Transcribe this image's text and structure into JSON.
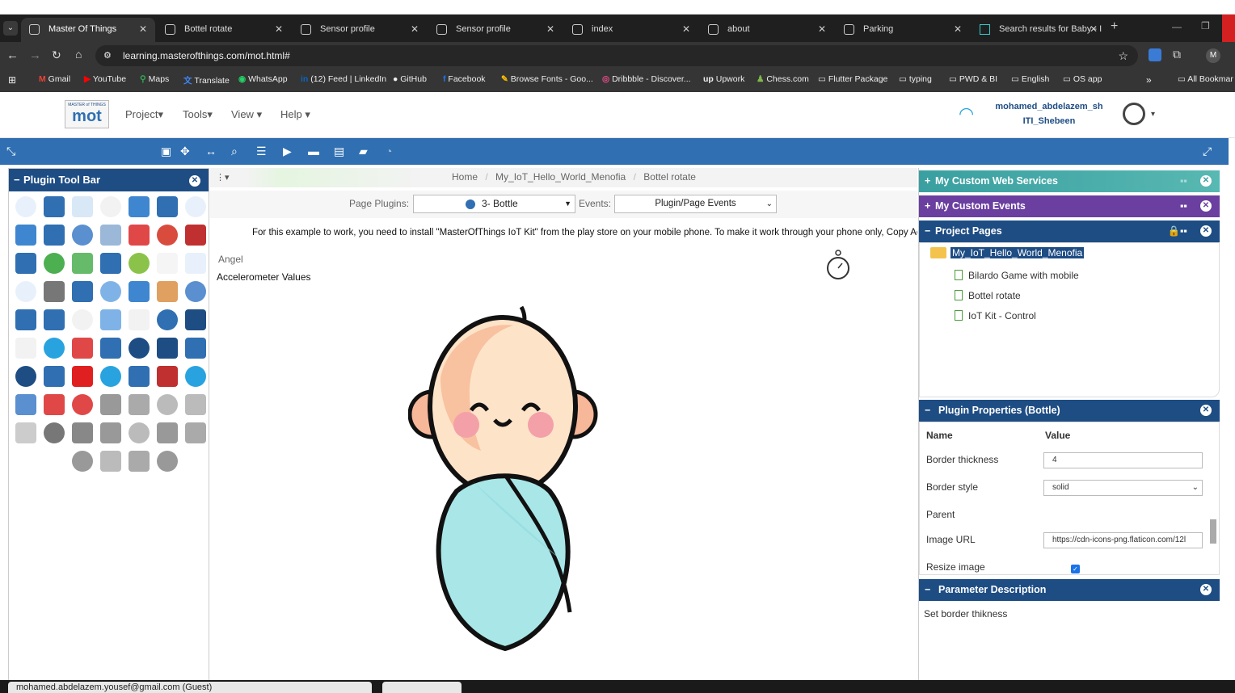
{
  "tabs": [
    {
      "title": "Master Of Things",
      "active": true
    },
    {
      "title": "Bottel rotate"
    },
    {
      "title": "Sensor profile"
    },
    {
      "title": "Sensor profile"
    },
    {
      "title": "index"
    },
    {
      "title": "about"
    },
    {
      "title": "Parking"
    },
    {
      "title": "Search results for Baby - I"
    }
  ],
  "address": {
    "url": "learning.masterofthings.com/mot.html#"
  },
  "bookmarks": [
    "Gmail",
    "YouTube",
    "Maps",
    "Translate",
    "WhatsApp",
    "(12) Feed | LinkedIn",
    "GitHub",
    "Facebook",
    "Browse Fonts - Goo...",
    "Dribbble - Discover...",
    "Upwork",
    "Chess.com",
    "Flutter Package",
    "typing",
    "PWD & BI",
    "English",
    "OS app",
    "All Bookmar"
  ],
  "app": {
    "logo_top": "MASTER of THINGS",
    "logo_main": "mot",
    "menus": [
      "Project",
      "Tools",
      "View",
      "Help"
    ],
    "user": {
      "name": "mohamed_abdelazem_sh",
      "org": "ITI_Shebeen"
    }
  },
  "left_panel": {
    "title": "Plugin Tool Bar"
  },
  "center": {
    "breadcrumb": [
      "Home",
      "My_IoT_Hello_World_Menofia",
      "Bottel rotate"
    ],
    "page_plugins_label": "Page Plugins:",
    "page_plugins_value": "3- Bottle",
    "events_label": "Events:",
    "events_value": "Plugin/Page Events",
    "info_text": "For this example to work, you need to install \"MasterOfThings IoT Kit\" from the play store on your mobile phone. To make it work through your phone only, Copy Acc",
    "angel_label": "Angel",
    "accel_label": "Accelerometer Values"
  },
  "right_panel": {
    "web_services": "My Custom Web Services",
    "custom_events": "My Custom Events",
    "project_pages": "Project Pages",
    "project_name": "My_IoT_Hello_World_Menofia",
    "pages": [
      "Bilardo Game with mobile",
      "Bottel rotate",
      "IoT Kit - Control"
    ],
    "plugin_props_title": "Plugin Properties (Bottle)",
    "col_name": "Name",
    "col_value": "Value",
    "props": [
      {
        "name": "Border thickness",
        "value": "4"
      },
      {
        "name": "Border style",
        "value": "solid"
      },
      {
        "name": "Parent",
        "value": ""
      },
      {
        "name": "Image URL",
        "value": "https://cdn-icons-png.flaticon.com/12l"
      },
      {
        "name": "Resize image",
        "value": ""
      }
    ],
    "param_title": "Parameter Description",
    "param_text": "Set border thikness"
  },
  "status": {
    "user_email": "mohamed.abdelazem.yousef@gmail.com (Guest)"
  },
  "colors": {
    "nav_blue": "#2f6fb2",
    "panel_header": "#1e4d84",
    "teal_header": "#3a9fa0",
    "purple_header": "#6a3fa0"
  }
}
